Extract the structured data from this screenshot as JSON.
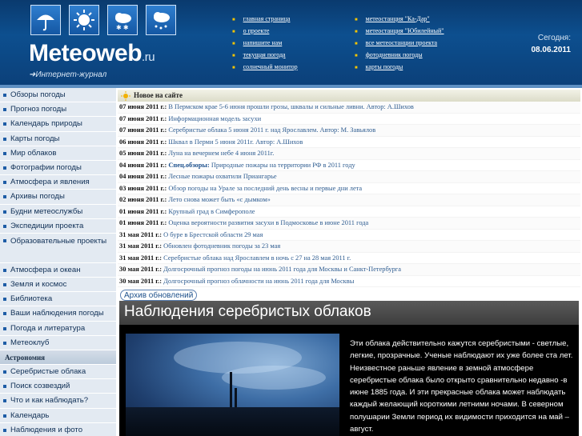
{
  "header": {
    "icons": [
      "umbrella-icon",
      "sun-icon",
      "cloud-snow-icon",
      "cloud-rain-icon"
    ],
    "logo": "Meteoweb",
    "logo_suffix": ".ru",
    "tagline": "➜Интернет-журнал",
    "nav_col1": [
      "главная страница",
      "о проекте",
      "напишите нам",
      "текущая погода",
      "солнечный монитор"
    ],
    "nav_col2": [
      "метеостанция \"Ка-Дар\"",
      "метеостанция \"Юбилейный\"",
      "все метеостанции проекта",
      "фотодневник погоды",
      "карты погоды"
    ],
    "today_label": "Сегодня:",
    "today_date": "08.06.2011"
  },
  "sidebar": {
    "items": [
      "Обзоры погоды",
      "Прогноз погоды",
      "Календарь природы",
      "Карты погоды",
      "Мир облаков",
      "Фотографии погоды",
      "Атмосфера и явления",
      "Архивы погоды",
      "Будни метеослужбы",
      "Экспедиции проекта",
      "Образовательные проекты",
      "Атмосфера и океан",
      "Земля и космос",
      "Библиотека",
      "Ваши наблюдения погоды",
      "Погода и литература",
      "Метеоклуб"
    ],
    "section_astronomy": "Астрономия",
    "astro_items": [
      "Серебристые облака",
      "Поиск созвездий",
      "Что и как наблюдать?",
      "Календарь",
      "Наблюдения и фото"
    ]
  },
  "news": {
    "heading": "Новое на сайте",
    "rows": [
      {
        "date": "07 июня 2011 г.:",
        "text": "В Пермском крае 5-6 июня прошли грозы, шквалы и сильные ливни. Автор: А.Шихов"
      },
      {
        "date": "07 июня 2011 г.:",
        "text": "Информационная модель засухи"
      },
      {
        "date": "07 июня 2011 г.:",
        "text": "Серебристые облака 5 июня 2011 г. над Ярославлем. Автор: М. Завьялов"
      },
      {
        "date": "06 июня 2011 г.:",
        "text": "Шквал в Перми 5 июня 2011г. Автор: А.Шихов"
      },
      {
        "date": "05 июня 2011 г.:",
        "text": "Луна на вечернем небе 4 июня 2011г."
      },
      {
        "date": "04 июня 2011 г.:",
        "special": "Спец.обзоры:",
        "text": "Природные пожары на территории РФ в 2011 году"
      },
      {
        "date": "04 июня 2011 г.:",
        "text": "Лесные пожары охватили Приангарье"
      },
      {
        "date": "03 июня 2011 г.:",
        "text": "Обзор погоды на Урале за последний день весны и первые дни лета"
      },
      {
        "date": "02 июня 2011 г.:",
        "text": "Лето снова может быть «с дымком»"
      },
      {
        "date": "01 июня 2011 г.:",
        "text": "Крупный град в Симферополе"
      },
      {
        "date": "01 июня 2011 г.:",
        "text": "Оценка вероятности развития засухи в Подмосковье в июне 2011 года"
      },
      {
        "date": "31 мая 2011 г.:",
        "text": "О буре в Брестской области 29 мая"
      },
      {
        "date": "31 мая 2011 г.:",
        "text": "Обновлен фотодневник погоды за 23 мая"
      },
      {
        "date": "31 мая 2011 г.:",
        "text": "Серебристые облака над Ярославлем в ночь с 27 на 28 мая 2011 г."
      },
      {
        "date": "30 мая 2011 г.:",
        "text": "Долгосрочный прогноз погоды на июнь 2011 года для Москвы и Санкт-Петербурга"
      },
      {
        "date": "30 мая 2011 г.:",
        "text": "Долгосрочный прогноз облачности на июнь 2011 года для Москвы"
      }
    ],
    "archive_label": "Архив обновлений"
  },
  "article": {
    "title": "Наблюдения серебристых облаков",
    "text": "Эти облака действительно кажутся серебристыми  - светлые, легкие, прозрачные. Ученые наблюдают их уже более ста лет. Неизвестное раньше явление в земной атмосфере  серебристые облака  было открыто сравнительно недавно  -в июне  1885 года. И эти прекрасные облака может наблюдать каждый желающий короткими летними ночами. В северном полушарии Земли период их видимости приходится на май – август."
  }
}
